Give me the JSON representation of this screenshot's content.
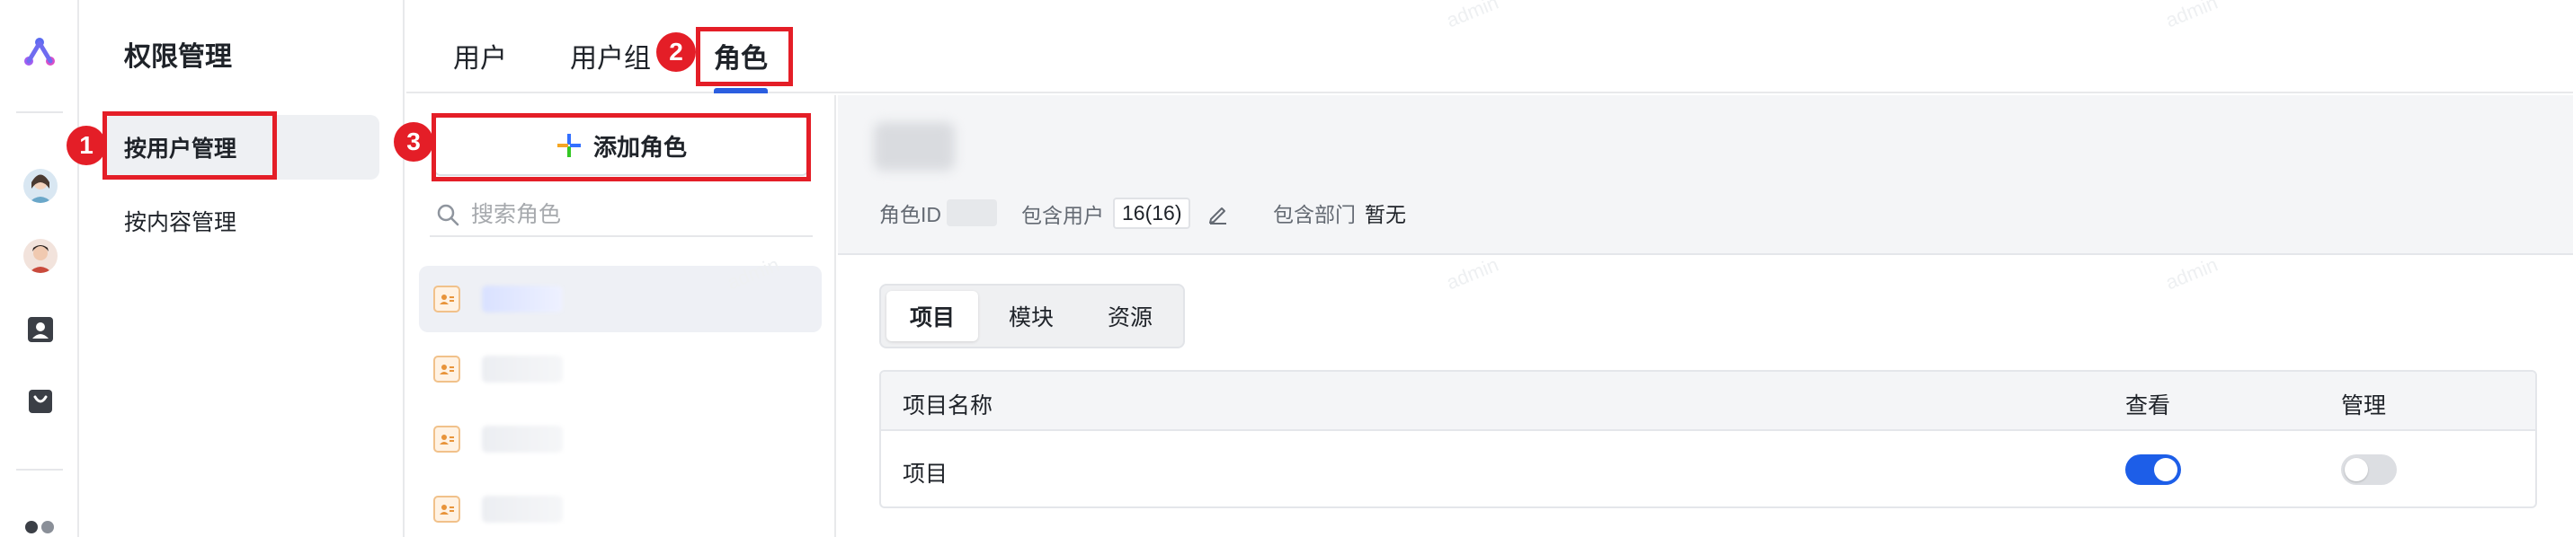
{
  "menu": {
    "title": "权限管理",
    "items": [
      {
        "label": "按用户管理",
        "active": true
      },
      {
        "label": "按内容管理",
        "active": false
      }
    ]
  },
  "tabs": [
    {
      "label": "用户",
      "active": false
    },
    {
      "label": "用户组",
      "active": false
    },
    {
      "label": "角色",
      "active": true
    }
  ],
  "roles_panel": {
    "add_label": "添加角色",
    "search_placeholder": "搜索角色"
  },
  "detail": {
    "role_id_label": "角色ID",
    "users_label": "包含用户",
    "users_value": "16(16)",
    "dept_label": "包含部门",
    "dept_value": "暂无",
    "segments": [
      {
        "label": "项目",
        "active": true
      },
      {
        "label": "模块",
        "active": false
      },
      {
        "label": "资源",
        "active": false
      }
    ],
    "table": {
      "columns": [
        "项目名称",
        "查看",
        "管理"
      ],
      "rows": [
        {
          "name": "项目",
          "view": true,
          "manage": false
        }
      ]
    }
  },
  "callouts": [
    "1",
    "2",
    "3"
  ],
  "watermark": "admin",
  "colors": {
    "accent": "#1d5ee8",
    "callout": "#e41e27",
    "role_icon": "#f1c18a"
  }
}
